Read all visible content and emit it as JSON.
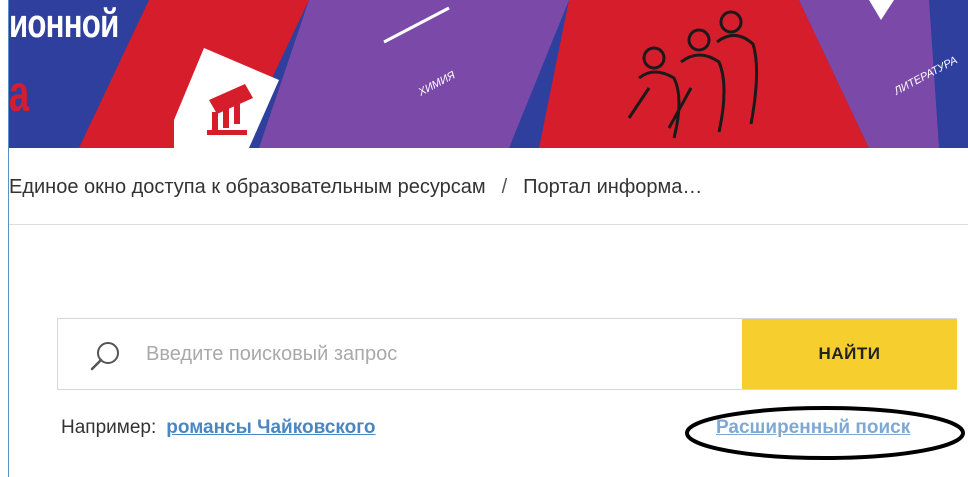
{
  "banner": {
    "logo_text": "ионной",
    "logo_letter": "а",
    "cards": [
      {
        "label": "ХИМИЯ"
      },
      {
        "label": "ЛИТЕРАТУРА"
      }
    ],
    "colors": {
      "red": "#d61d2b",
      "purple": "#7b4aa8",
      "blue": "#2f3f9e",
      "yellow": "#f6cf2e"
    }
  },
  "breadcrumb": {
    "items": [
      "Единое окно доступа к образовательным ресурсам",
      "Портал информа…"
    ],
    "separator": "/"
  },
  "search": {
    "placeholder": "Введите поисковый запрос",
    "value": "",
    "button_label": "НАЙТИ",
    "icon": "search-icon"
  },
  "example": {
    "prefix": "Например:",
    "link": "романсы Чайковского"
  },
  "advanced_search": {
    "label": "Расширенный поиск"
  }
}
